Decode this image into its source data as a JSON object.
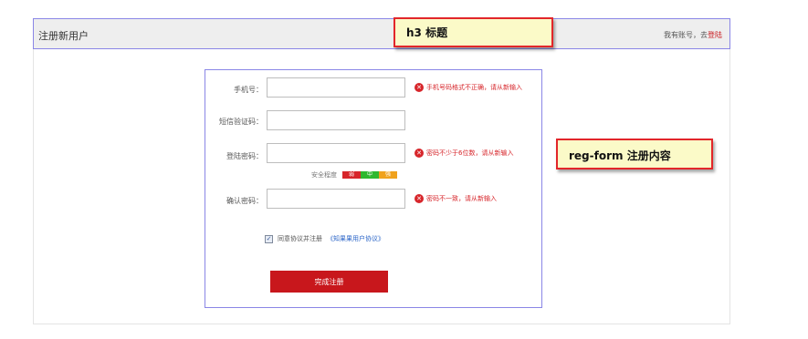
{
  "header": {
    "title": "注册新用户",
    "login_prompt": "我有账号，去",
    "login_link": "登陆"
  },
  "annotations": {
    "h3": "h3 标题",
    "form": "reg-form 注册内容"
  },
  "form": {
    "phone": {
      "label": "手机号：",
      "value": "",
      "error": "手机号码格式不正确，请从新输入"
    },
    "sms": {
      "label": "短信验证码：",
      "value": ""
    },
    "password": {
      "label": "登陆密码：",
      "value": "",
      "error": "密码不少于6位数，请从新输入"
    },
    "strength": {
      "label": "安全程度",
      "levels": [
        "弱",
        "中",
        "强"
      ],
      "colors": [
        "#d7262b",
        "#2eb82e",
        "#f0a21d"
      ]
    },
    "confirm": {
      "label": "确认密码：",
      "value": "",
      "error": "密码不一致，请从新输入"
    },
    "agree": {
      "checked": true,
      "text": "同意协议并注册",
      "link": "《知果果用户协议》"
    },
    "submit": "完成注册"
  },
  "colors": {
    "accent": "#c8171c",
    "annotation_border": "#8a86e6",
    "link": "#2c66c8"
  }
}
